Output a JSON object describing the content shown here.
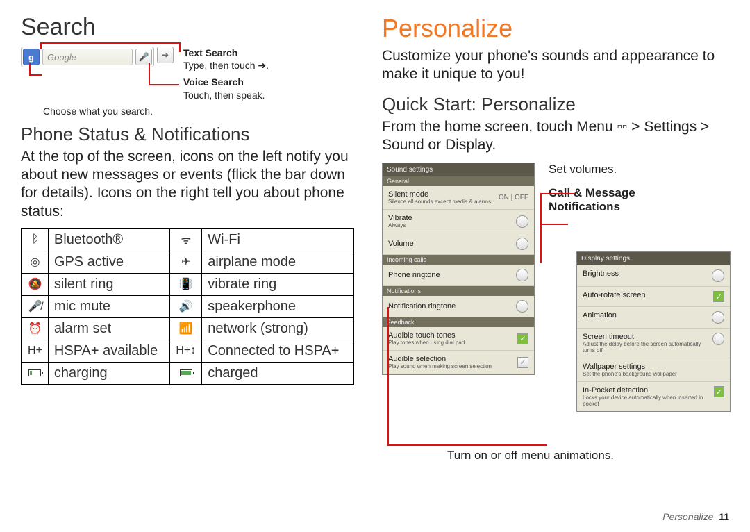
{
  "left": {
    "h1": "Search",
    "callouts": {
      "text_title": "Text Search",
      "text_desc": "Type, then touch",
      "voice_title": "Voice Search",
      "voice_desc": "Touch, then speak."
    },
    "search_placeholder": "Google",
    "choose_caption": "Choose what you search.",
    "h2": "Phone Status & Notifications",
    "para": "At the top of the screen, icons on the left notify you about new messages or events (flick the bar down for details). Icons on the right tell you about phone status:",
    "table": [
      {
        "i1": "ᛒ",
        "l1": "Bluetooth®",
        "i2": "ᯤ",
        "l2": "Wi-Fi"
      },
      {
        "i1": "◎",
        "l1": "GPS active",
        "i2": "✈",
        "l2": "airplane mode"
      },
      {
        "i1": "🔕",
        "l1": "silent ring",
        "i2": "📳",
        "l2": "vibrate ring"
      },
      {
        "i1": "🎤̸",
        "l1": "mic mute",
        "i2": "🔊",
        "l2": "speakerphone"
      },
      {
        "i1": "⏰",
        "l1": "alarm set",
        "i2": "📶",
        "l2": "network (strong)"
      },
      {
        "i1": "H+",
        "l1": "HSPA+ available",
        "i2": "H+↕",
        "l2": "Connected to HSPA+"
      },
      {
        "i1": "bat20",
        "l1": "charging",
        "i2": "bat100",
        "l2": "charged"
      }
    ]
  },
  "right": {
    "h1": "Personalize",
    "intro": "Customize your phone's sounds and appearance to make it unique to you!",
    "h2": "Quick Start: Personalize",
    "from": "From the home screen, touch Menu ▫▫ > Settings > Sound or Display.",
    "ann_volumes": "Set volumes.",
    "ann_call_title": "Call & Message",
    "ann_call_sub": "Notifications",
    "ann_anim": "Turn on or off menu animations.",
    "sound": {
      "title": "Sound settings",
      "sec_general": "General",
      "silent": "Silent mode",
      "silent_sub": "Silence all sounds except media & alarms",
      "vibrate": "Vibrate",
      "vibrate_sub": "Always",
      "volume": "Volume",
      "sec_incoming": "Incoming calls",
      "ringtone": "Phone ringtone",
      "sec_notif": "Notifications",
      "notif_ring": "Notification ringtone",
      "sec_feedback": "Feedback",
      "touch_tones": "Audible touch tones",
      "touch_tones_sub": "Play tones when using dial pad",
      "aud_sel": "Audible selection",
      "aud_sel_sub": "Play sound when making screen selection"
    },
    "display": {
      "title": "Display settings",
      "brightness": "Brightness",
      "autorotate": "Auto-rotate screen",
      "animation": "Animation",
      "timeout": "Screen timeout",
      "timeout_sub": "Adjust the delay before the screen automatically turns off",
      "wallpaper": "Wallpaper settings",
      "wallpaper_sub": "Set the phone's background wallpaper",
      "pocket": "In-Pocket detection",
      "pocket_sub": "Locks your device automatically when inserted in pocket"
    },
    "footer_section": "Personalize",
    "footer_page": "11"
  }
}
